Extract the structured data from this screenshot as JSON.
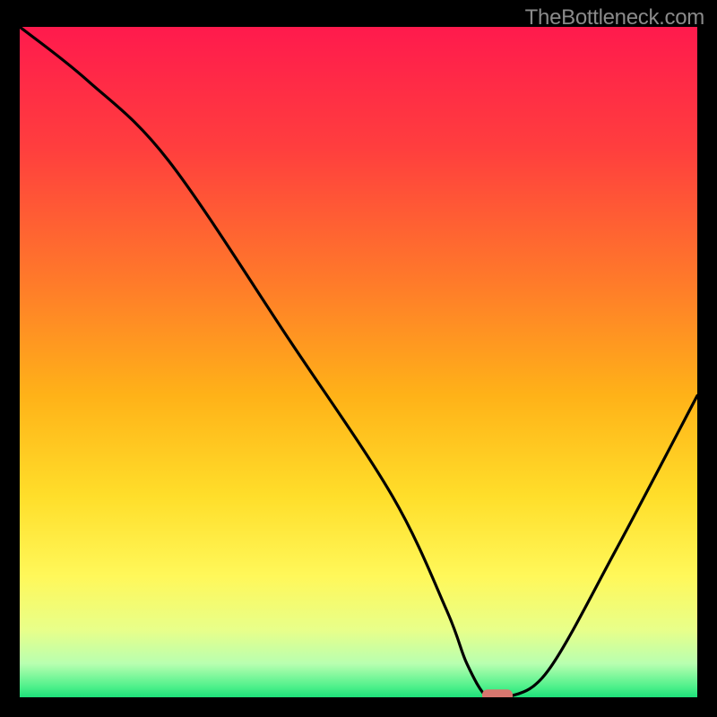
{
  "watermark": "TheBottleneck.com",
  "chart_data": {
    "type": "line",
    "title": "",
    "xlabel": "",
    "ylabel": "",
    "xlim": [
      0,
      100
    ],
    "ylim": [
      0,
      100
    ],
    "series": [
      {
        "name": "bottleneck-curve",
        "x": [
          0,
          10,
          22,
          40,
          55,
          63,
          66,
          69,
          72,
          78,
          88,
          100
        ],
        "values": [
          100,
          92,
          80,
          53,
          30,
          13,
          5,
          0,
          0,
          4,
          22,
          45
        ]
      }
    ],
    "marker": {
      "x": 70.5,
      "y": 0,
      "color": "#d7776f",
      "width": 4.5,
      "height": 1.8
    },
    "gradient_stops": [
      {
        "offset": 0,
        "color": "#ff1a4d"
      },
      {
        "offset": 0.18,
        "color": "#ff3e3e"
      },
      {
        "offset": 0.38,
        "color": "#ff7a2a"
      },
      {
        "offset": 0.55,
        "color": "#ffb218"
      },
      {
        "offset": 0.7,
        "color": "#ffde2a"
      },
      {
        "offset": 0.82,
        "color": "#fff85a"
      },
      {
        "offset": 0.9,
        "color": "#e8ff8a"
      },
      {
        "offset": 0.95,
        "color": "#b8ffb0"
      },
      {
        "offset": 0.985,
        "color": "#4cf08a"
      },
      {
        "offset": 1.0,
        "color": "#1ee07a"
      }
    ]
  }
}
